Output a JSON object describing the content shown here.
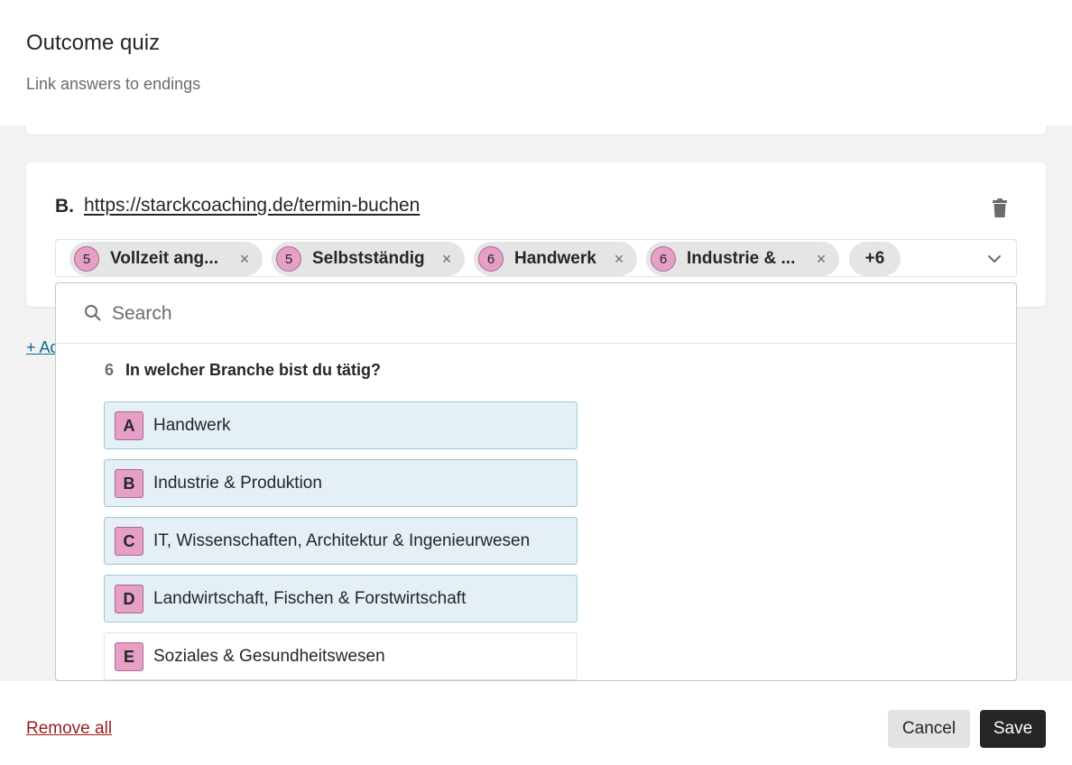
{
  "header": {
    "title": "Outcome quiz",
    "subtitle": "Link answers to endings"
  },
  "ending": {
    "letter": "B.",
    "url": "https://starckcoaching.de/termin-buchen",
    "delete_icon": "trash-icon",
    "chips": [
      {
        "question": "5",
        "label": "Vollzeit ang..."
      },
      {
        "question": "5",
        "label": "Selbstständig"
      },
      {
        "question": "6",
        "label": "Handwerk"
      },
      {
        "question": "6",
        "label": "Industrie & ..."
      }
    ],
    "more_count": "+6",
    "remove_glyph": "×",
    "expand_icon": "chevron-down-icon"
  },
  "add_link": "+ Ad",
  "dropdown": {
    "search_placeholder": "Search",
    "search_icon": "search-icon",
    "question_number": "6",
    "question_text": "In welcher Branche bist du tätig?",
    "options": [
      {
        "letter": "A",
        "label": "Handwerk",
        "selected": true
      },
      {
        "letter": "B",
        "label": "Industrie & Produktion",
        "selected": true
      },
      {
        "letter": "C",
        "label": "IT, Wissenschaften, Architektur & Ingenieurwesen",
        "selected": true
      },
      {
        "letter": "D",
        "label": "Landwirtschaft, Fischen & Forstwirtschaft",
        "selected": true
      },
      {
        "letter": "E",
        "label": "Soziales & Gesundheitswesen",
        "selected": false
      }
    ]
  },
  "footer": {
    "remove_all": "Remove all",
    "cancel": "Cancel",
    "save": "Save"
  },
  "colors": {
    "chip_badge": "#e69fc6",
    "selected_option_bg": "#e4f0f5",
    "save_bg": "#262627",
    "danger_link": "#9a1b1b",
    "add_link": "#0c6b8c"
  }
}
